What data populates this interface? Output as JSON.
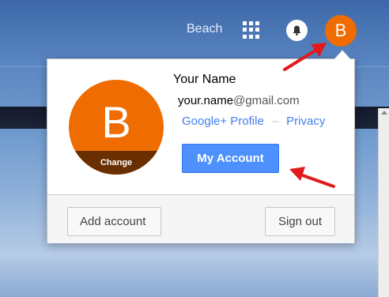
{
  "topbar": {
    "link_label": "Beach",
    "apps_icon": "apps-grid-icon",
    "notifications_icon": "bell-icon",
    "avatar_letter": "B"
  },
  "popup": {
    "avatar_letter": "B",
    "change_label": "Change",
    "name": "Your Name",
    "email_user": "your.name",
    "email_domain": "@gmail.com",
    "profile_link": "Google+ Profile",
    "separator": "–",
    "privacy_link": "Privacy",
    "my_account_button": "My Account",
    "add_account_button": "Add account",
    "sign_out_button": "Sign out"
  },
  "colors": {
    "avatar": "#ef6c00",
    "primary_button": "#4d90fe",
    "link": "#427fed",
    "annotation_arrow": "#e11b1b"
  }
}
